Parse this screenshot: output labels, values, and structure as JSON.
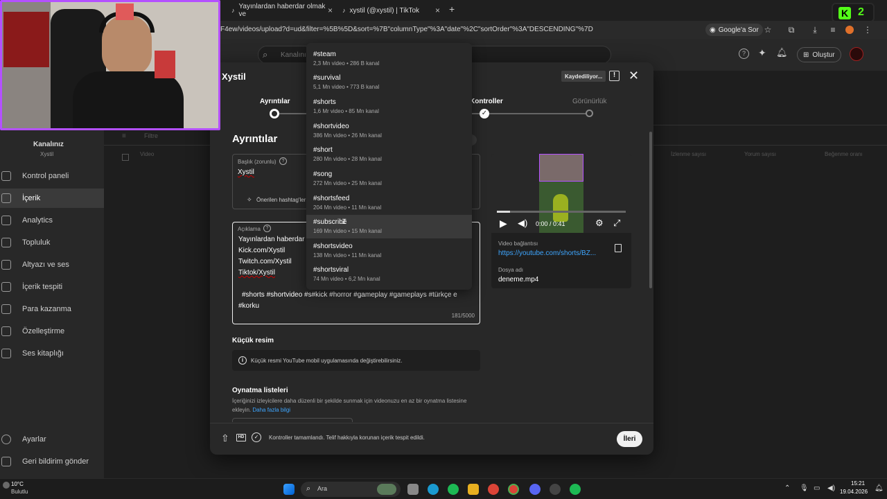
{
  "browser": {
    "tabs": [
      {
        "label": "Yayınlardan haberdar olmak ve"
      },
      {
        "label": "xystil (@xystil) | TikTok"
      }
    ],
    "new_tab": "+",
    "url": "F4ew/videos/upload?d=ud&filter=%5B%5D&sort=%7B\"columnType\"%3A\"date\"%2C\"sortOrder\"%3A\"DESCENDING\"%7D",
    "google_sor": "Google'a Sor",
    "extension_badge": "2"
  },
  "studio": {
    "search_placeholder": "Kanalını",
    "create_label": "Oluştur",
    "channel_title": "Kanalınız",
    "channel_name": "Xystil",
    "sidebar": [
      {
        "label": "Kontrol paneli"
      },
      {
        "label": "İçerik"
      },
      {
        "label": "Analytics"
      },
      {
        "label": "Topluluk"
      },
      {
        "label": "Altyazı ve ses"
      },
      {
        "label": "İçerik tespiti"
      },
      {
        "label": "Para kazanma"
      },
      {
        "label": "Özelleştirme"
      },
      {
        "label": "Ses kitaplığı"
      }
    ],
    "sidebar_bottom": [
      {
        "label": "Ayarlar"
      },
      {
        "label": "Geri bildirim gönder"
      }
    ],
    "filter_label": "Filtre",
    "table_headers": {
      "video": "Video",
      "views": "İzlenme sayısı",
      "comments": "Yorum sayısı",
      "likes": "Beğenme oranı"
    }
  },
  "modal": {
    "title": "Xystil",
    "saving": "Kaydediliyor...",
    "steps": [
      {
        "label": "Ayrıntılar"
      },
      {
        "label": "Kontroller"
      },
      {
        "label": "Görünürlük"
      }
    ],
    "heading": "Ayrıntılar",
    "title_field": {
      "label": "Başlık (zorunlu)",
      "value": "Xystil",
      "suggest": "Önerilen hashtag'ler"
    },
    "desc_field": {
      "label": "Açıklama",
      "lines": [
        "Yayınlardan haberdar",
        "Kick.com/Xystil",
        "Twitch.com/Xystil",
        "Tiktok/Xystil"
      ],
      "hashtags_1": "#shorts #shortvideo #s#kick  #horror  #gameplay  #gameplays  #türkçe e",
      "hashtags_2": "#korku",
      "counter": "181/5000"
    },
    "thumbnail": {
      "heading": "Küçük resim",
      "info": "Küçük resmi YouTube mobil uygulamasında değiştirebilirsiniz."
    },
    "playlists": {
      "heading": "Oynatma listeleri",
      "desc": "İçeriğinizi izleyicilere daha düzenli bir şekilde sunmak için videonuzu en az bir oynatma listesine ekleyin.",
      "link": "Daha fazla bilgi"
    },
    "preview": {
      "time": "0:00 / 0:41",
      "link_label": "Video bağlantısı",
      "link": "https://youtube.com/shorts/BZ...",
      "file_label": "Dosya adı",
      "file_name": "deneme.mp4"
    },
    "footer": {
      "status": "Kontroller tamamlandı. Telif hakkıyla korunan içerik tespit edildi.",
      "next": "İleri"
    }
  },
  "dropdown": [
    {
      "tag": "#steam",
      "meta": "2,3 Mn video • 286 B kanal"
    },
    {
      "tag": "#survival",
      "meta": "5,1 Mn video • 773 B kanal"
    },
    {
      "tag": "#shorts",
      "meta": "1,6 Mr video • 85 Mn kanal"
    },
    {
      "tag": "#shortvideo",
      "meta": "386 Mn video • 26 Mn kanal"
    },
    {
      "tag": "#short",
      "meta": "280 Mn video • 28 Mn kanal"
    },
    {
      "tag": "#song",
      "meta": "272 Mn video • 25 Mn kanal"
    },
    {
      "tag": "#shortsfeed",
      "meta": "204 Mn video • 11 Mn kanal"
    },
    {
      "tag": "#subscribe",
      "meta": "169 Mn video • 15 Mn kanal"
    },
    {
      "tag": "#shortsvideo",
      "meta": "138 Mn video • 11 Mn kanal"
    },
    {
      "tag": "#shortsviral",
      "meta": "74 Mn video • 6,2 Mn kanal"
    }
  ],
  "taskbar": {
    "weather_temp": "10°C",
    "weather_desc": "Bulutlu",
    "search": "Ara",
    "time": "15:21",
    "date": "19.04.2026"
  },
  "colors": {
    "accent_link": "#3ea6ff",
    "webcam_border": "#b450ff",
    "error_red": "#cc0000"
  }
}
